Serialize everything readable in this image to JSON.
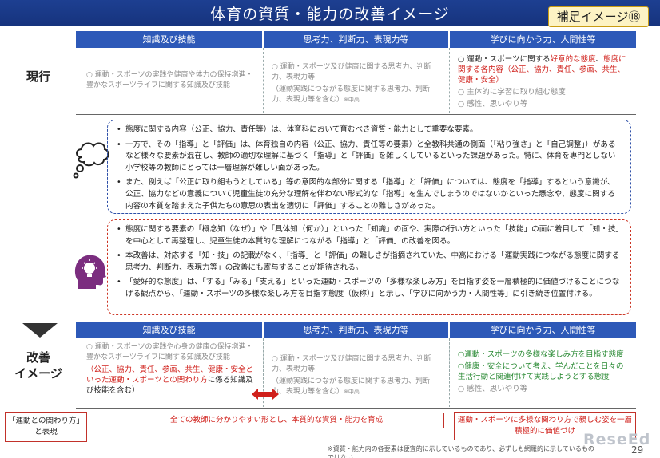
{
  "title": "体育の資質・能力の改善イメージ",
  "badge": "補足イメージ⑱",
  "columns": [
    "知識及び技能",
    "思考力、判断力、表現力等",
    "学びに向かう力、人間性等"
  ],
  "current": {
    "label": "現行",
    "col1": "○ 運動・スポーツの実践や健康や体力の保持増進・豊かなスポーツライフに関する知識及び技能",
    "col2_a": "○ 運動・スポーツ及び健康に関する思考力、判断力、表現力等",
    "col2_b": "（運動実践につながる態度に関する思考力、判断力、表現力等を含む）",
    "col2_note": "※中高",
    "col3_a_pre": "○ 運動・スポーツに関する",
    "col3_a_red": "好意的な態度",
    "col3_a_mid": "、",
    "col3_a_red2": "態度に関する各内容（公正、協力、責任、参画、共生、健康・安全）",
    "col3_b": "○ 主体的に学習に取り組む態度",
    "col3_c": "○ 感性、思いやり等"
  },
  "blue_box": {
    "items": [
      "態度に関する内容（公正、協力、責任等）は、体育科において育むべき資質・能力として重要な要素。",
      "一方で、その「指導」と「評価」は、体育独自の内容（公正、協力、責任等の要素）と全教科共通の側面（「粘り強さ」と「自己調整」）があるなど様々な要素が混在し、教師の適切な理解に基づく「指導」と「評価」を難しくしているといった課題があった。特に、体育を専門としない小学校等の教師にとっては一層理解が難しい面があった。",
      "また、例えば「公正に取り組もうとしている」等の意図的な部分に関する「指導」と「評価」については、態度を「指導」するという意識が、公正、協力などの意義について児童生徒の充分な理解を伴わない形式的な「指導」を生んでしまうのではないかといった懸念や、態度に関する内容の本質を踏まえた子供たちの意思の表出を適切に「評価」することの難しさがあった。"
    ]
  },
  "red_box": {
    "items": [
      "態度に関する要素の「概念知（なぜ）」や「具体知（何か）」といった「知識」の面や、実際の行い方といった「技能」の面に着目して「知・技」を中心として再整理し、児童生徒の本質的な理解につながる「指導」と「評価」の改善を図る。",
      "本改善は、対応する「知・技」の記載がなく、「指導」と「評価」の難しさが指摘されていた、中高における「運動実践につながる態度に関する思考力、判断力、表現力等」の改善にも寄与することが期待される。",
      "「愛好的な態度」は、「する」「みる」「支える」といった運動・スポーツの「多様な楽しみ方」を目指す姿を一層積極的に価値づけることにつなげる観点から、「運動・スポーツの多様な楽しみ方を目指す態度（仮称）」と示し、「学びに向かう力・人間性等」に引き続き位置付ける。"
    ]
  },
  "improved": {
    "label_1": "改善",
    "label_2": "イメージ",
    "col1_a": "○ 運動・スポーツの実践や心身の健康の保持増進・豊かなスポーツライフに関する知識及び技能",
    "col1_red": "（公正、協力、責任、参画、共生、健康・安全といった運動・スポーツとの関わり方",
    "col1_dark": "に係る知識及び技能を含む）",
    "col2_a": "○ 運動・スポーツ及び健康に関する思考力、判断力、表現力等",
    "col2_b": "（運動実践につながる態度に関する思考力、判断力、表現力等を含む）",
    "col2_note": "※中高",
    "col3_a": "○運動・スポーツの多様な楽しみ方を目指す態度",
    "col3_b": "○健康・安全について考え、学んだことを日々の生活行動と関連付けて実践しようとする態度",
    "col3_c": "○ 感性、思いやり等"
  },
  "note_left": "「運動との関わり方」と表現",
  "bar_center": "全ての教師に分かりやすい形とし、本質的な資質・能力を育成",
  "bar_right": "運動・スポーツに多様な関わり方で親しむ姿を一層積極的に価値づけ",
  "footnote": "※資質・能力内の各要素は便宜的に示しているものであり、必ずしも網羅的に示しているものではない。",
  "page_number": "29",
  "watermark": "ReseEd",
  "colors": {
    "header_blue": "#2d59b8",
    "title_blue": "#1d3f91",
    "accent_red": "#d0201b",
    "accent_green": "#2a8a34"
  },
  "icons": [
    "thought-cloud-icon",
    "lightbulb-head-icon",
    "double-arrow-icon",
    "down-triangle-icon"
  ]
}
